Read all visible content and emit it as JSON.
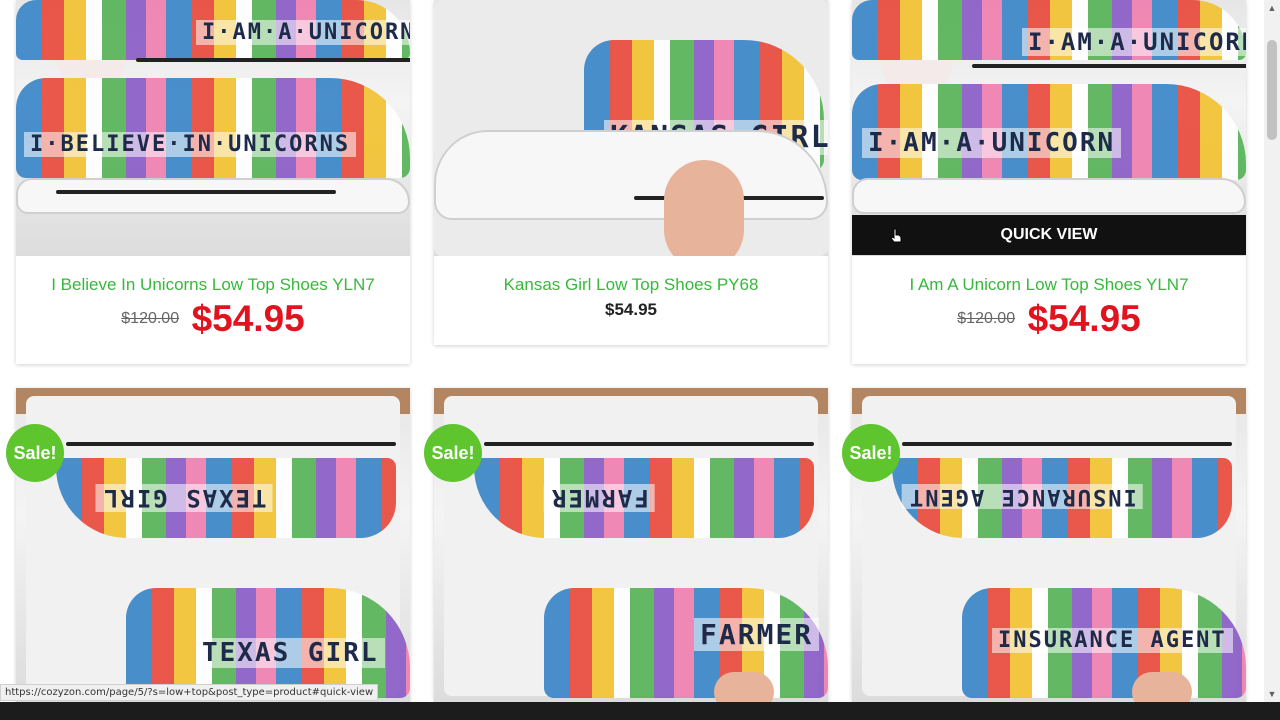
{
  "products": [
    {
      "title": "I Believe In Unicorns Low Top Shoes YLN7",
      "old_price": "$120.00",
      "price": "$54.95",
      "shoe_text": "I·BELIEVE·IN·UNICORNS",
      "on_sale": false
    },
    {
      "title": "Kansas Girl Low Top Shoes PY68",
      "old_price": "",
      "price": "$54.95",
      "shoe_text": "KANSAS GIRL",
      "on_sale": false
    },
    {
      "title": "I Am A Unicorn Low Top Shoes YLN7",
      "old_price": "$120.00",
      "price": "$54.95",
      "shoe_text": "I·AM·A·UNICORN",
      "on_sale": false,
      "quick_view": "QUICK VIEW"
    },
    {
      "shoe_text": "TEXAS GIRL",
      "on_sale": true
    },
    {
      "shoe_text": "FARMER",
      "on_sale": true
    },
    {
      "shoe_text": "INSURANCE AGENT",
      "on_sale": true
    }
  ],
  "sale_label": "Sale!",
  "status_url": "https://cozyzon.com/page/5/?s=low+top&post_type=product#quick-view",
  "colors": {
    "title_green": "#37b83c",
    "sale_red": "#e0131f",
    "badge_green": "#5ec52e"
  },
  "icons": {
    "cursor": "hand-pointer-icon",
    "scroll_up": "chevron-up-icon",
    "scroll_down": "chevron-down-icon"
  }
}
